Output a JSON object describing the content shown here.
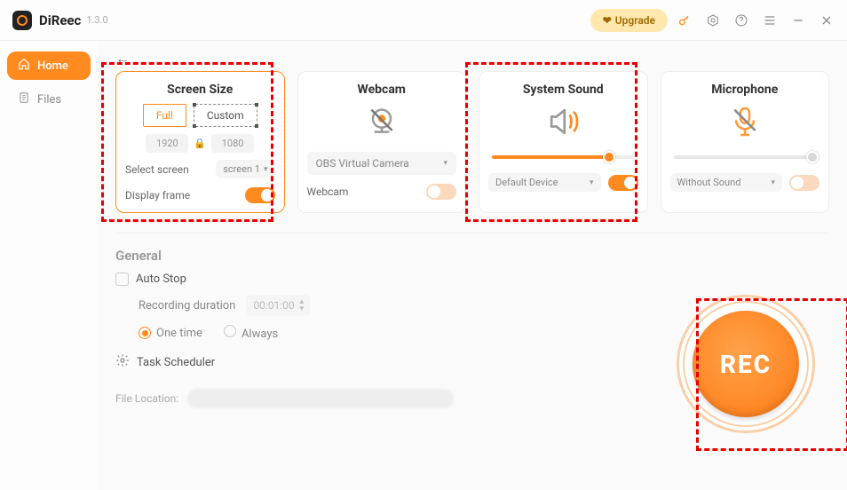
{
  "app": {
    "name": "DiReec",
    "version": "1.3.0"
  },
  "topbar": {
    "upgrade": "Upgrade"
  },
  "sidebar": {
    "items": [
      {
        "label": "Home",
        "active": true
      },
      {
        "label": "Files",
        "active": false
      }
    ]
  },
  "cards": {
    "screen": {
      "title": "Screen Size",
      "full": "Full",
      "custom": "Custom",
      "width": "1920",
      "height": "1080",
      "select_label": "Select screen",
      "screen_value": "screen 1",
      "display_frame_label": "Display frame",
      "display_frame_on": true
    },
    "webcam": {
      "title": "Webcam",
      "source": "OBS Virtual Camera",
      "toggle_label": "Webcam",
      "on": false
    },
    "sound": {
      "title": "System Sound",
      "level_pct": 82,
      "device": "Default Device",
      "on": true
    },
    "mic": {
      "title": "Microphone",
      "level_pct": 100,
      "device": "Without Sound",
      "on": false
    }
  },
  "general": {
    "title": "General",
    "auto_stop": "Auto Stop",
    "duration_label": "Recording duration",
    "duration_value": "00:01:00",
    "one_time": "One time",
    "always": "Always",
    "task_scheduler": "Task Scheduler",
    "file_location_label": "File Location:"
  },
  "rec": {
    "label": "REC"
  }
}
